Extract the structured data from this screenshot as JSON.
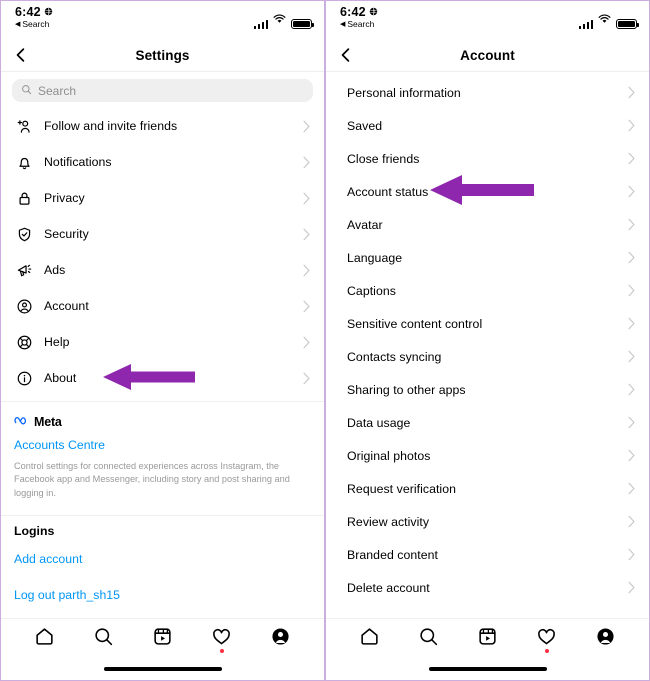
{
  "colors": {
    "accent_link": "#0095f6",
    "arrow_purple": "#8E27AE",
    "badge_red": "#ff3040",
    "frame_border": "#cbaedd",
    "chevron_grey": "#c7c7c7",
    "search_bg": "#efefef"
  },
  "left_screen": {
    "status_bar": {
      "time": "6:42",
      "location_icon": "location-globe-icon",
      "back_app": "Search",
      "signal_icon": "cellular-signal-icon",
      "wifi_icon": "wifi-icon",
      "battery_icon": "battery-full-icon"
    },
    "header": {
      "back_icon": "chevron-left-icon",
      "title": "Settings"
    },
    "search": {
      "placeholder": "Search",
      "icon": "search-icon"
    },
    "menu_items": [
      {
        "icon": "person-add-icon",
        "label": "Follow and invite friends"
      },
      {
        "icon": "bell-icon",
        "label": "Notifications"
      },
      {
        "icon": "lock-icon",
        "label": "Privacy"
      },
      {
        "icon": "shield-check-icon",
        "label": "Security"
      },
      {
        "icon": "megaphone-icon",
        "label": "Ads"
      },
      {
        "icon": "account-circle-icon",
        "label": "Account"
      },
      {
        "icon": "lifebuoy-icon",
        "label": "Help"
      },
      {
        "icon": "info-circle-icon",
        "label": "About"
      }
    ],
    "meta_section": {
      "brand": "Meta",
      "brand_icon": "meta-infinity-icon",
      "accounts_centre_link": "Accounts Centre",
      "description": "Control settings for connected experiences across Instagram, the Facebook app and Messenger, including story and post sharing and logging in."
    },
    "logins_section": {
      "heading": "Logins",
      "add_account_link": "Add account",
      "logout_link": "Log out parth_sh15"
    },
    "annotation": {
      "type": "arrow-left",
      "points_at": "Account"
    },
    "tabbar": [
      {
        "icon": "home-icon",
        "badge": false
      },
      {
        "icon": "search-icon",
        "badge": false
      },
      {
        "icon": "reels-icon",
        "badge": false
      },
      {
        "icon": "heart-icon",
        "badge": true
      },
      {
        "icon": "profile-icon",
        "badge": false
      }
    ]
  },
  "right_screen": {
    "status_bar": {
      "time": "6:42",
      "location_icon": "location-globe-icon",
      "back_app": "Search",
      "signal_icon": "cellular-signal-icon",
      "wifi_icon": "wifi-icon",
      "battery_icon": "battery-full-icon"
    },
    "header": {
      "back_icon": "chevron-left-icon",
      "title": "Account"
    },
    "menu_items": [
      {
        "label": "Personal information"
      },
      {
        "label": "Saved"
      },
      {
        "label": "Close friends"
      },
      {
        "label": "Account status"
      },
      {
        "label": "Avatar"
      },
      {
        "label": "Language"
      },
      {
        "label": "Captions"
      },
      {
        "label": "Sensitive content control"
      },
      {
        "label": "Contacts syncing"
      },
      {
        "label": "Sharing to other apps"
      },
      {
        "label": "Data usage"
      },
      {
        "label": "Original photos"
      },
      {
        "label": "Request verification"
      },
      {
        "label": "Review activity"
      },
      {
        "label": "Branded content"
      },
      {
        "label": "Delete account"
      }
    ],
    "annotation": {
      "type": "arrow-left",
      "points_at": "Account status"
    },
    "tabbar": [
      {
        "icon": "home-icon",
        "badge": false
      },
      {
        "icon": "search-icon",
        "badge": false
      },
      {
        "icon": "reels-icon",
        "badge": false
      },
      {
        "icon": "heart-icon",
        "badge": true
      },
      {
        "icon": "profile-icon",
        "badge": false
      }
    ]
  }
}
